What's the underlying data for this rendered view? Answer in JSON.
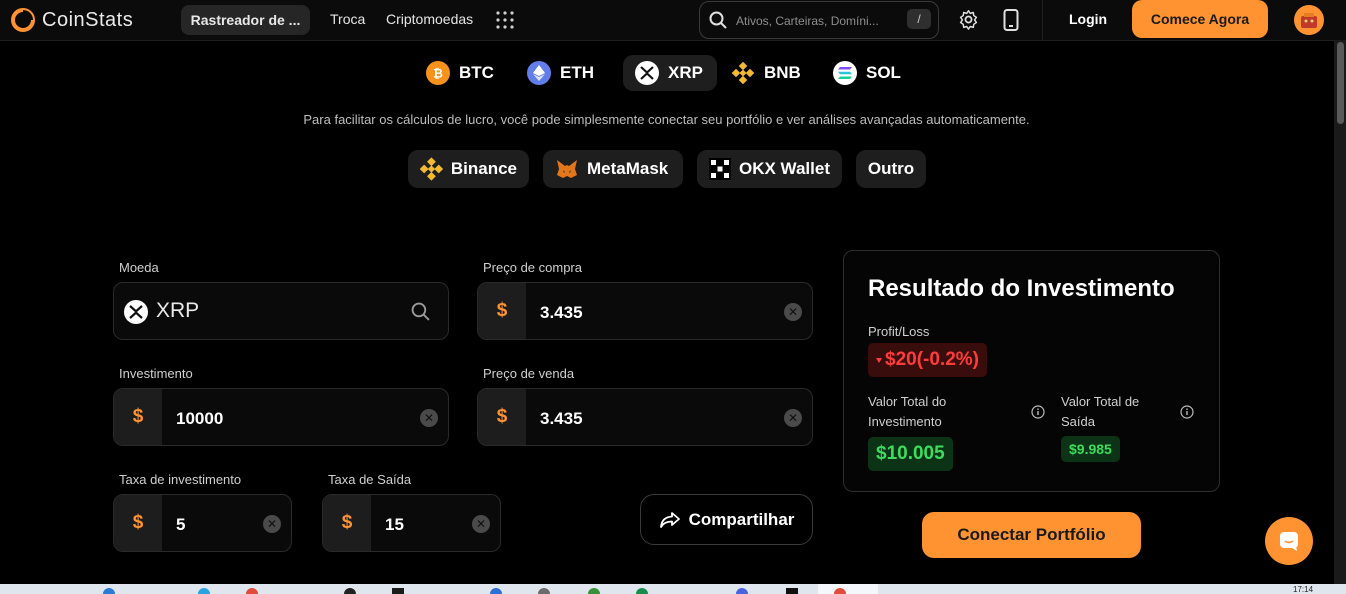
{
  "header": {
    "brand": "CoinStats",
    "nav_active": "Rastreador de ...",
    "nav_links": [
      "Troca",
      "Criptomoedas"
    ],
    "search_placeholder": "Ativos, Carteiras, Domíni...",
    "search_shortcut": "/",
    "login_label": "Login",
    "cta_label": "Comece Agora"
  },
  "coin_tabs": [
    {
      "label": "BTC",
      "icon": "bitcoin-icon",
      "color": "#f7931a",
      "active": false
    },
    {
      "label": "ETH",
      "icon": "ethereum-icon",
      "color": "#627eea",
      "active": false
    },
    {
      "label": "XRP",
      "icon": "xrp-icon",
      "color": "#ffffff",
      "active": true
    },
    {
      "label": "BNB",
      "icon": "bnb-icon",
      "color": "#f3ba2f",
      "active": false
    },
    {
      "label": "SOL",
      "icon": "solana-icon",
      "color": "#14f195",
      "active": false
    }
  ],
  "hint_text": "Para facilitar os cálculos de lucro, você pode simplesmente conectar seu portfólio e ver análises avançadas automaticamente.",
  "wallets": [
    {
      "label": "Binance",
      "icon": "binance-icon"
    },
    {
      "label": "MetaMask",
      "icon": "metamask-icon"
    },
    {
      "label": "OKX Wallet",
      "icon": "okx-icon"
    },
    {
      "label": "Outro",
      "icon": ""
    }
  ],
  "form": {
    "coin_label": "Moeda",
    "coin_value": "XRP",
    "buy_price_label": "Preço de compra",
    "buy_price_value": "3.435",
    "investment_label": "Investimento",
    "investment_value": "10000",
    "sell_price_label": "Preço de venda",
    "sell_price_value": "3.435",
    "investment_fee_label": "Taxa de investimento",
    "investment_fee_value": "5",
    "exit_fee_label": "Taxa de Saída",
    "exit_fee_value": "15",
    "currency_symbol": "$",
    "share_label": "Compartilhar"
  },
  "result": {
    "title": "Resultado do Investimento",
    "profit_loss_label": "Profit/Loss",
    "profit_loss_value": "$20(-0.2%)",
    "total_investment_label": "Valor Total do Investimento",
    "total_investment_value": "$10.005",
    "total_exit_label": "Valor Total de Saída",
    "total_exit_value": "$9.985"
  },
  "connect_portfolio_label": "Conectar Portfólio",
  "taskbar": {
    "clock": "17:14"
  },
  "colors": {
    "accent": "#ff9332",
    "loss": "#ff3b3b",
    "gain": "#3ddc5f"
  }
}
